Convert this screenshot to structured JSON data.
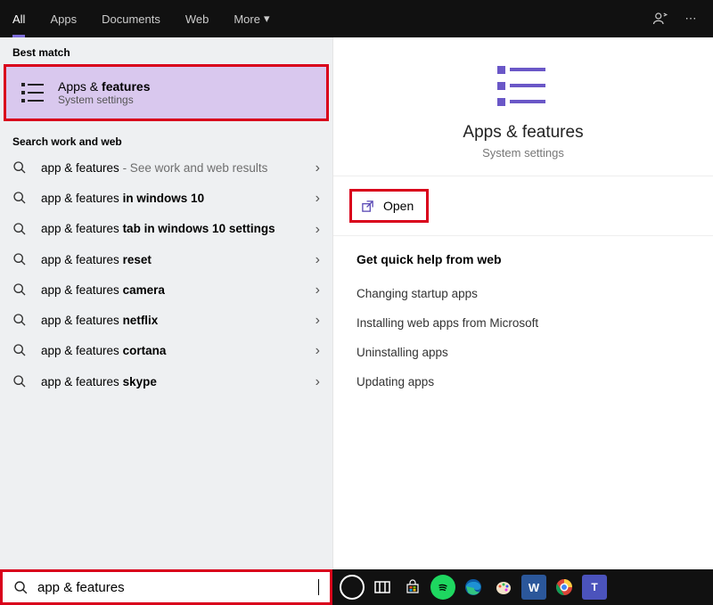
{
  "tabs": {
    "all": "All",
    "apps": "Apps",
    "documents": "Documents",
    "web": "Web",
    "more": "More"
  },
  "sections": {
    "best_match": "Best match",
    "search_web": "Search work and web"
  },
  "best_match": {
    "title_pre": "Apps & ",
    "title_bold": "features",
    "subtitle": "System settings"
  },
  "results": [
    {
      "plain": "app & features",
      "suffix_dim": " - See work and web results"
    },
    {
      "plain": "app & features ",
      "bold": "in windows 10"
    },
    {
      "plain": "app & features ",
      "bold": "tab in windows 10 settings"
    },
    {
      "plain": "app & features ",
      "bold": "reset"
    },
    {
      "plain": "app & features ",
      "bold": "camera"
    },
    {
      "plain": "app & features ",
      "bold": "netflix"
    },
    {
      "plain": "app & features ",
      "bold": "cortana"
    },
    {
      "plain": "app & features ",
      "bold": "skype"
    }
  ],
  "preview": {
    "title": "Apps & features",
    "subtitle": "System settings",
    "open": "Open",
    "help_header": "Get quick help from web",
    "help_links": [
      "Changing startup apps",
      "Installing web apps from Microsoft",
      "Uninstalling apps",
      "Updating apps"
    ]
  },
  "search": {
    "value": "app & features"
  },
  "taskbar": [
    "cortana",
    "task-view",
    "store",
    "spotify",
    "edge",
    "paint",
    "word",
    "chrome",
    "teams"
  ]
}
